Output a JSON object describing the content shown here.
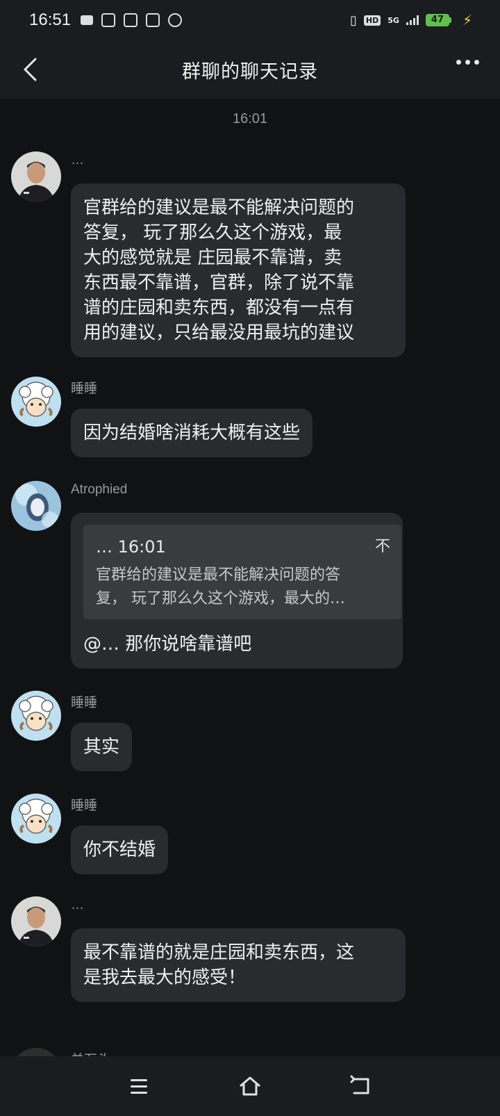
{
  "status_bar": {
    "time": "16:51",
    "hd": "HD",
    "network": "5G",
    "battery": "47"
  },
  "nav": {
    "title": "群聊的聊天记录"
  },
  "chat": {
    "timestamp": "16:01",
    "messages": [
      {
        "sender": "…",
        "avatar": "photo-man-avatar",
        "text_lines": [
          "官群给的建议是最不能解决问题的",
          "答复，  玩了那么久这个游戏，最",
          "大的感觉就是  庄园最不靠谱，卖",
          "东西最不靠谱，官群，除了说不靠",
          "谱的庄园和卖东西，都没有一点有",
          "用的建议，只给最没用最坑的建议"
        ]
      },
      {
        "sender": "睡睡",
        "avatar": "sheep-cartoon-avatar",
        "text_lines": [
          "因为结婚啥消耗大概有这些"
        ]
      },
      {
        "sender": "Atrophied",
        "avatar": "anime-girl-avatar",
        "quote": {
          "header": "… 16:01",
          "pin": "不",
          "lines": [
            "官群给的建议是最不能解决问题的答",
            "复，  玩了那么久这个游戏，最大的…"
          ]
        },
        "text_lines": [
          "@… 那你说啥靠谱吧"
        ]
      },
      {
        "sender": "睡睡",
        "avatar": "sheep-cartoon-avatar",
        "text_lines": [
          "其实"
        ]
      },
      {
        "sender": "睡睡",
        "avatar": "sheep-cartoon-avatar",
        "text_lines": [
          "你不结婚"
        ]
      },
      {
        "sender": "…",
        "avatar": "photo-man-avatar",
        "text_lines": [
          "最不靠谱的就是庄园和卖东西，这",
          "是我去最大的感受！"
        ]
      },
      {
        "sender": "羊石头",
        "avatar": "partial-avatar"
      }
    ]
  },
  "bottom_nav": {
    "icons": [
      "menu-icon",
      "home-icon",
      "back-icon"
    ]
  },
  "colors": {
    "background": "#111214",
    "bar": "#1b1c1f",
    "bubble": "#2a2b2e",
    "quote": "#3a3b3e",
    "battery": "#5ec24a"
  }
}
